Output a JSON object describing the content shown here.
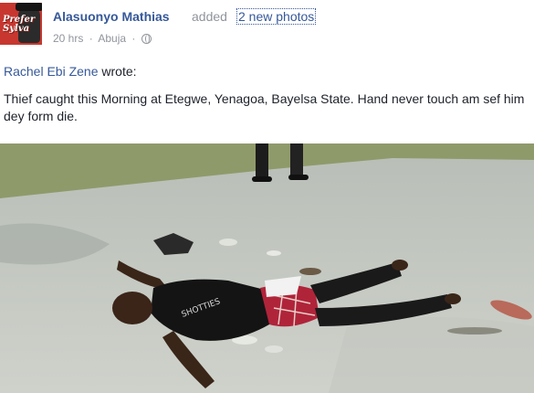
{
  "post": {
    "author": "Alasuonyo Mathias",
    "action": "added",
    "photos_link": "2 new photos",
    "time": "20 hrs",
    "separator": "·",
    "location": "Abuja",
    "separator2": "·",
    "privacy_icon": "globe-icon",
    "avatar_text_line1": "Prefer",
    "avatar_text_line2": "Sylva",
    "wrote_author": "Rachel Ebi Zene",
    "wrote_verb": "wrote:",
    "body": "Thief caught this Morning at Etegwe, Yenagoa, Bayelsa State. Hand never touch am sef him dey form die.",
    "shirt_text": "SHOTTIES",
    "colors": {
      "link": "#365899",
      "meta": "#90949c",
      "text": "#1d2129",
      "avatar_bg": "#c7372f"
    }
  }
}
